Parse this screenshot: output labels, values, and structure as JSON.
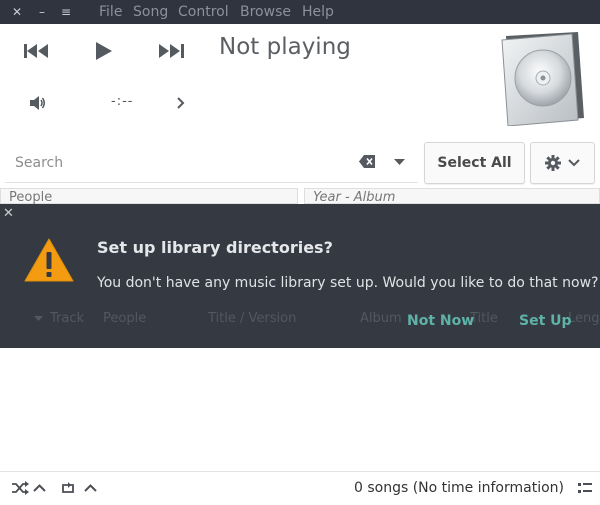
{
  "window": {
    "close_glyph": "✕",
    "minimize_glyph": "–",
    "menu_glyph": "≡"
  },
  "menu": {
    "items": [
      "File",
      "Song",
      "Control",
      "Browse",
      "Help"
    ]
  },
  "player": {
    "status": "Not playing",
    "time": "-:--"
  },
  "search": {
    "placeholder": "Search"
  },
  "toolbar": {
    "select_all": "Select All"
  },
  "browser": {
    "columns": [
      "People",
      "Year - Album"
    ]
  },
  "songlist": {
    "columns": [
      "Track",
      "People",
      "Title / Version",
      "Album",
      "Title",
      "Length"
    ]
  },
  "infobar": {
    "title": "Set up library directories?",
    "message": "You don't have any music library set up. Would you like to do that now?",
    "not_now": "Not Now",
    "set_up": "Set Up"
  },
  "statusbar": {
    "text": "0 songs (No time information)"
  },
  "colors": {
    "menubar_bg": "#2f343f",
    "infobar_bg": "#353a42",
    "accent": "#5fb2a8",
    "warning": "#f39c12"
  }
}
